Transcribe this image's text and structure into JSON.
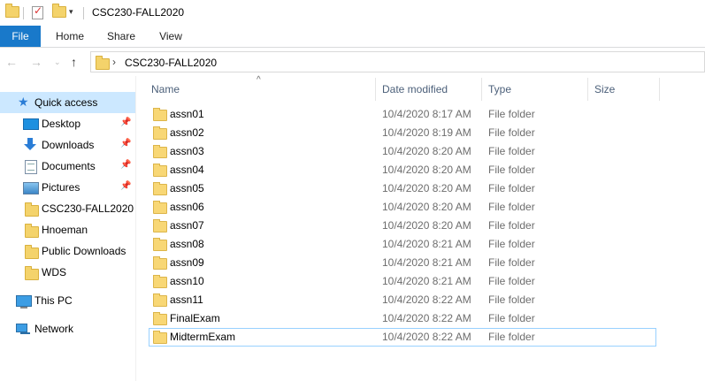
{
  "window": {
    "title": "CSC230-FALL2020"
  },
  "ribbon": {
    "tabs": [
      {
        "label": "File"
      },
      {
        "label": "Home"
      },
      {
        "label": "Share"
      },
      {
        "label": "View"
      }
    ]
  },
  "address": {
    "breadcrumb": "CSC230-FALL2020"
  },
  "sidebar": {
    "items": [
      {
        "label": "Quick access",
        "icon": "star-icon"
      },
      {
        "label": "Desktop",
        "icon": "desktop-icon",
        "pinned": true
      },
      {
        "label": "Downloads",
        "icon": "download-arrow-icon",
        "pinned": true
      },
      {
        "label": "Documents",
        "icon": "document-icon",
        "pinned": true
      },
      {
        "label": "Pictures",
        "icon": "pictures-icon",
        "pinned": true
      },
      {
        "label": "CSC230-FALL2020",
        "icon": "folder-icon"
      },
      {
        "label": "Hnoeman",
        "icon": "folder-icon"
      },
      {
        "label": "Public Downloads",
        "icon": "folder-icon"
      },
      {
        "label": "WDS",
        "icon": "folder-icon"
      },
      {
        "label": "This PC",
        "icon": "computer-icon"
      },
      {
        "label": "Network",
        "icon": "network-icon"
      }
    ]
  },
  "columns": {
    "name": "Name",
    "date": "Date modified",
    "type": "Type",
    "size": "Size"
  },
  "files": [
    {
      "name": "assn01",
      "date": "10/4/2020 8:17 AM",
      "type": "File folder"
    },
    {
      "name": "assn02",
      "date": "10/4/2020 8:19 AM",
      "type": "File folder"
    },
    {
      "name": "assn03",
      "date": "10/4/2020 8:20 AM",
      "type": "File folder"
    },
    {
      "name": "assn04",
      "date": "10/4/2020 8:20 AM",
      "type": "File folder"
    },
    {
      "name": "assn05",
      "date": "10/4/2020 8:20 AM",
      "type": "File folder"
    },
    {
      "name": "assn06",
      "date": "10/4/2020 8:20 AM",
      "type": "File folder"
    },
    {
      "name": "assn07",
      "date": "10/4/2020 8:20 AM",
      "type": "File folder"
    },
    {
      "name": "assn08",
      "date": "10/4/2020 8:21 AM",
      "type": "File folder"
    },
    {
      "name": "assn09",
      "date": "10/4/2020 8:21 AM",
      "type": "File folder"
    },
    {
      "name": "assn10",
      "date": "10/4/2020 8:21 AM",
      "type": "File folder"
    },
    {
      "name": "assn11",
      "date": "10/4/2020 8:22 AM",
      "type": "File folder"
    },
    {
      "name": "FinalExam",
      "date": "10/4/2020 8:22 AM",
      "type": "File folder"
    },
    {
      "name": "MidtermExam",
      "date": "10/4/2020 8:22 AM",
      "type": "File folder"
    }
  ],
  "colors": {
    "file_tab_bg": "#1979ca",
    "selected_nav_bg": "#cce8ff",
    "folder_yellow": "#f8d775",
    "focus_border": "#99d1ff"
  }
}
